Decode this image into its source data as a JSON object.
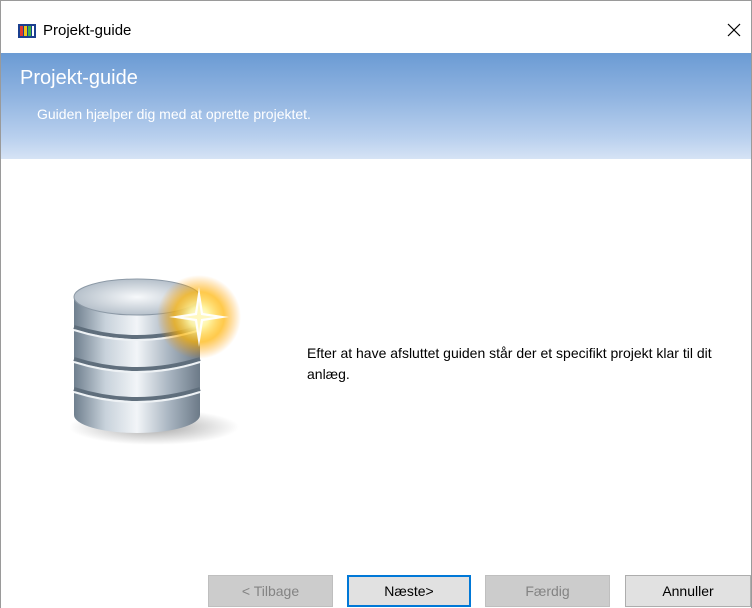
{
  "window": {
    "title": "Projekt-guide",
    "app_icon": "wizard-app-icon",
    "close_icon": "close-icon"
  },
  "header": {
    "title": "Projekt-guide",
    "subtitle": "Guiden hjælper dig med at oprette projektet."
  },
  "content": {
    "image": "database-sparkle-icon",
    "message": "Efter at have afsluttet guiden står der et specifikt projekt klar til dit anlæg."
  },
  "buttons": {
    "back": "< Tilbage",
    "next": "Næste>",
    "finish": "Færdig",
    "cancel": "Annuller"
  },
  "colors": {
    "header_top": "#6b9bd4",
    "header_bottom": "#d6e3f5",
    "focus_border": "#0078d7",
    "disabled_text": "#838383"
  }
}
